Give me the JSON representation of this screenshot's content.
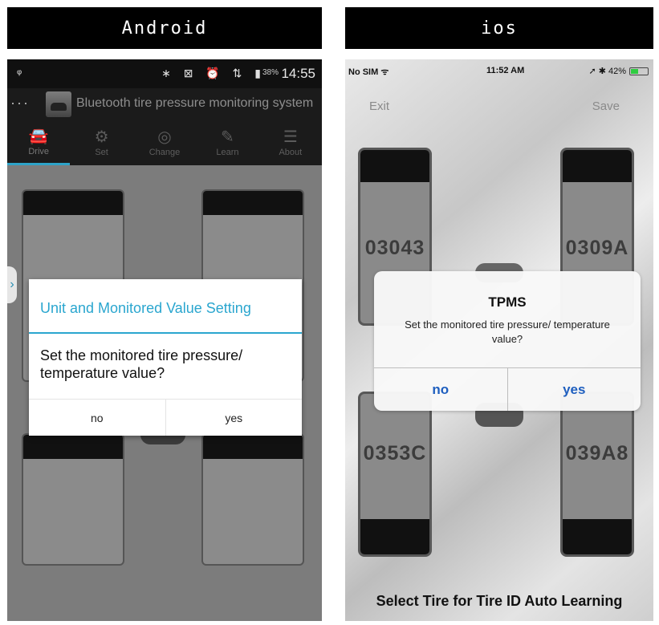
{
  "headers": {
    "android": "Android",
    "ios": "ios"
  },
  "android": {
    "status": {
      "usb_icon": "usb-icon",
      "icons": "∗ ⊠ ⏰ ⇅ ▮",
      "battery": "38%",
      "time": "14:55"
    },
    "app_title": "Bluetooth tire pressure monitoring system",
    "tabs": [
      {
        "label": "Drive",
        "icon": "car-icon"
      },
      {
        "label": "Set",
        "icon": "gear-icon"
      },
      {
        "label": "Change",
        "icon": "tire-icon"
      },
      {
        "label": "Learn",
        "icon": "edit-icon"
      },
      {
        "label": "About",
        "icon": "list-icon"
      }
    ],
    "active_tab": "Drive",
    "dialog": {
      "title": "Unit and Monitored Value Setting",
      "message": "Set the monitored tire pressure/ temperature value?",
      "no": "no",
      "yes": "yes"
    }
  },
  "ios": {
    "status": {
      "carrier": "No SIM ᯤ",
      "time": "11:52 AM",
      "right": "➚ ✱ 42%"
    },
    "exit": "Exit",
    "save": "Save",
    "tires": {
      "front_left": "03043",
      "front_right": "0309A",
      "rear_left": "0353C",
      "rear_right": "039A8"
    },
    "dialog": {
      "title": "TPMS",
      "message": "Set the monitored tire pressure/ temperature value?",
      "no": "no",
      "yes": "yes"
    },
    "footer": "Select Tire for Tire ID Auto Learning"
  },
  "colors": {
    "accent_android": "#2aa6cf",
    "ios_button": "#1f5fbf",
    "battery_green": "#2ecc40"
  }
}
